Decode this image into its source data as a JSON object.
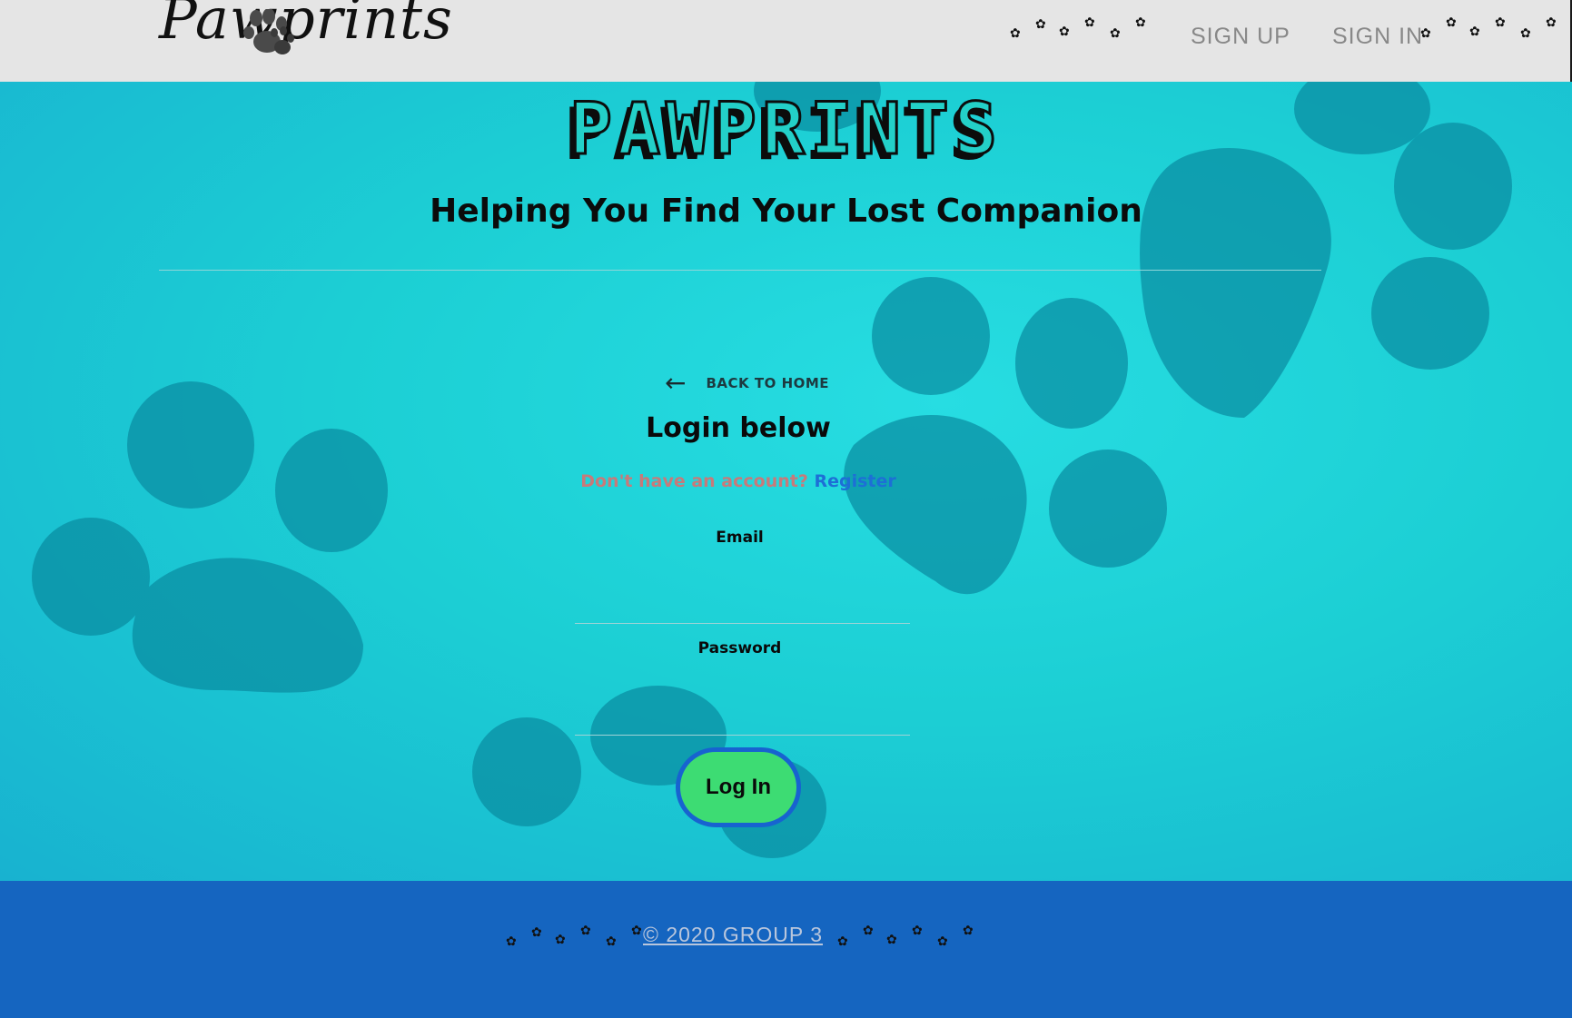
{
  "header": {
    "logo_text": "Pawprints",
    "nav": {
      "signup_label": "SIGN UP",
      "signin_label": "SIGN IN"
    }
  },
  "hero": {
    "title": "PAWPRINTS",
    "tagline": "Helping You Find Your Lost Companion"
  },
  "login": {
    "back_label": "BACK TO HOME",
    "title": "Login below",
    "register_prompt": "Don't have an account?",
    "register_link": "Register",
    "email_label": "Email",
    "email_value": "",
    "password_label": "Password",
    "password_value": "",
    "submit_label": "Log In"
  },
  "footer": {
    "copyright": "© 2020 GROUP 3"
  },
  "colors": {
    "header_bg": "#e5e5e5",
    "hero_teal": "#1ccfd4",
    "paw_dark": "#0a8aa0",
    "button_green": "#3ddc73",
    "button_border": "#1763d0",
    "footer_blue": "#1565c0",
    "register_link": "#1d6fd6"
  }
}
